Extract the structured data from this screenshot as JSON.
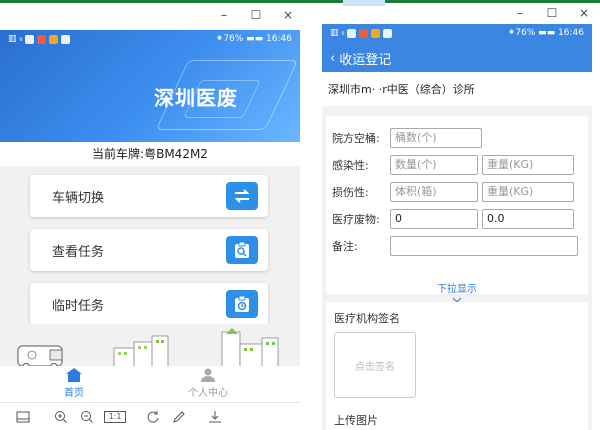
{
  "left_phone": {
    "window_controls": [
      "–",
      "☐",
      "×"
    ],
    "status": {
      "signal": "▥ ᵢₗ",
      "battery": "⁕76% ▬▬ 16:46"
    },
    "title": "深圳医废",
    "plate_prefix": "当前车牌:",
    "plate_value": "粤BM42M2",
    "menu": [
      {
        "label": "车辆切换",
        "icon": "swap-arrows-icon"
      },
      {
        "label": "查看任务",
        "icon": "clipboard-search-icon"
      },
      {
        "label": "临时任务",
        "icon": "clipboard-clock-icon"
      }
    ],
    "tabs": [
      {
        "label": "首页",
        "icon": "home-icon",
        "active": true
      },
      {
        "label": "个人中心",
        "icon": "person-icon",
        "active": false
      }
    ],
    "toolbar_page": "1:1",
    "colors": {
      "accent": "#2c8fe8",
      "header": "#3a86e0",
      "active_tab": "#2c7ce0"
    }
  },
  "right_phone": {
    "window_controls": [
      "–",
      "☐",
      "×"
    ],
    "status": {
      "signal": "▥ ᵢₗ",
      "battery": "⁕76% ▬▬ 16:46"
    },
    "nav_title": "收运登记",
    "org_name": "深圳市m·      ·r中医（综合）诊所",
    "fields": [
      {
        "label": "院方空桶:",
        "inputs": [
          {
            "placeholder": "桶数(个)",
            "value": ""
          }
        ]
      },
      {
        "label": "感染性:",
        "inputs": [
          {
            "placeholder": "数量(个)",
            "value": ""
          },
          {
            "placeholder": "重量(KG)",
            "value": ""
          }
        ]
      },
      {
        "label": "损伤性:",
        "inputs": [
          {
            "placeholder": "体积(箱)",
            "value": ""
          },
          {
            "placeholder": "重量(KG)",
            "value": ""
          }
        ]
      },
      {
        "label": "医疗废物:",
        "inputs": [
          {
            "placeholder": "",
            "value": "0"
          },
          {
            "placeholder": "",
            "value": "0.0"
          }
        ]
      },
      {
        "label": "备注:",
        "inputs": [
          {
            "placeholder": "",
            "value": ""
          }
        ]
      }
    ],
    "more_label": "下拉显示",
    "signature_title": "医疗机构签名",
    "signature_placeholder": "点击签名",
    "upload_title": "上传图片"
  }
}
